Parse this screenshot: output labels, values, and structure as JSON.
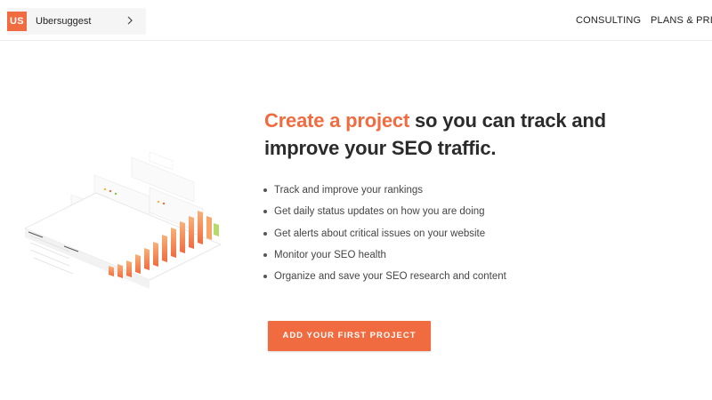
{
  "header": {
    "brand_logo_text": "US",
    "brand_name": "Ubersuggest",
    "nav": {
      "consulting": "CONSULTING",
      "plans": "PLANS & PRICING"
    }
  },
  "hero": {
    "headline_accent": "Create a project",
    "headline_rest_line1": " so you can track and",
    "headline_line2": "improve your SEO traffic.",
    "features": [
      "Track and improve your rankings",
      "Get daily status updates on how you are doing",
      "Get alerts about critical issues on your website",
      "Monitor your SEO health",
      "Organize and save your SEO research and content"
    ],
    "cta_label": "ADD YOUR FIRST PROJECT"
  },
  "icons": {
    "brand_chevron": "chevron-right-icon",
    "illustration": "dashboard-illustration-icon"
  },
  "colors": {
    "accent": "#f06b3f",
    "text": "#2b2b2b",
    "brand_bg": "#f5f5f5"
  }
}
